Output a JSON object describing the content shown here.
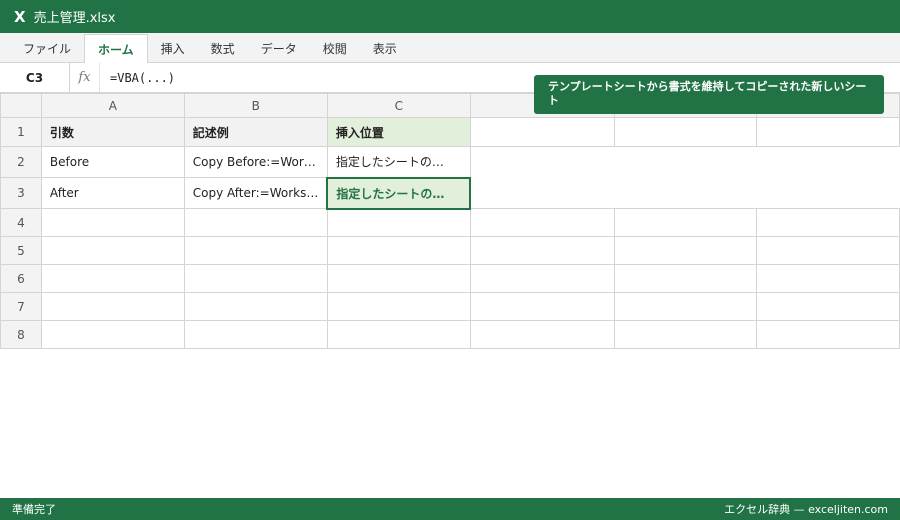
{
  "window": {
    "title": "売上管理.xlsx",
    "logo": "X"
  },
  "ribbon": {
    "tabs": [
      "ファイル",
      "ホーム",
      "挿入",
      "数式",
      "データ",
      "校閲",
      "表示"
    ],
    "active_tab": "ホーム"
  },
  "formula_bar": {
    "name_box": "C3",
    "fx": "fx",
    "formula": "=VBA(...)"
  },
  "tooltip": {
    "text": "テンプレートシートから書式を維持してコピーされた新しいシート"
  },
  "sheet": {
    "columns": [
      "A",
      "B",
      "C",
      "",
      "",
      ""
    ],
    "rows": [
      {
        "num": "1",
        "cells": [
          "引数",
          "記述例",
          "挿入位置",
          "",
          "",
          ""
        ]
      },
      {
        "num": "2",
        "cells": [
          "Before",
          "Copy Before:=Wor…",
          "指定したシートの…"
        ]
      },
      {
        "num": "3",
        "cells": [
          "After",
          "Copy After:=Works…",
          "指定したシートの…"
        ]
      },
      {
        "num": "4",
        "cells": [
          "",
          "",
          "",
          "",
          "",
          ""
        ]
      },
      {
        "num": "5",
        "cells": [
          "",
          "",
          "",
          "",
          "",
          ""
        ]
      },
      {
        "num": "6",
        "cells": [
          "",
          "",
          "",
          "",
          "",
          ""
        ]
      },
      {
        "num": "7",
        "cells": [
          "",
          "",
          "",
          "",
          "",
          ""
        ]
      },
      {
        "num": "8",
        "cells": [
          "",
          "",
          "",
          "",
          "",
          ""
        ]
      }
    ],
    "selected_cell": "C3"
  },
  "status_bar": {
    "left": "準備完了",
    "right": "エクセル辞典 — exceljiten.com"
  },
  "colors": {
    "accent": "#217346",
    "highlight": "#e2efda"
  }
}
